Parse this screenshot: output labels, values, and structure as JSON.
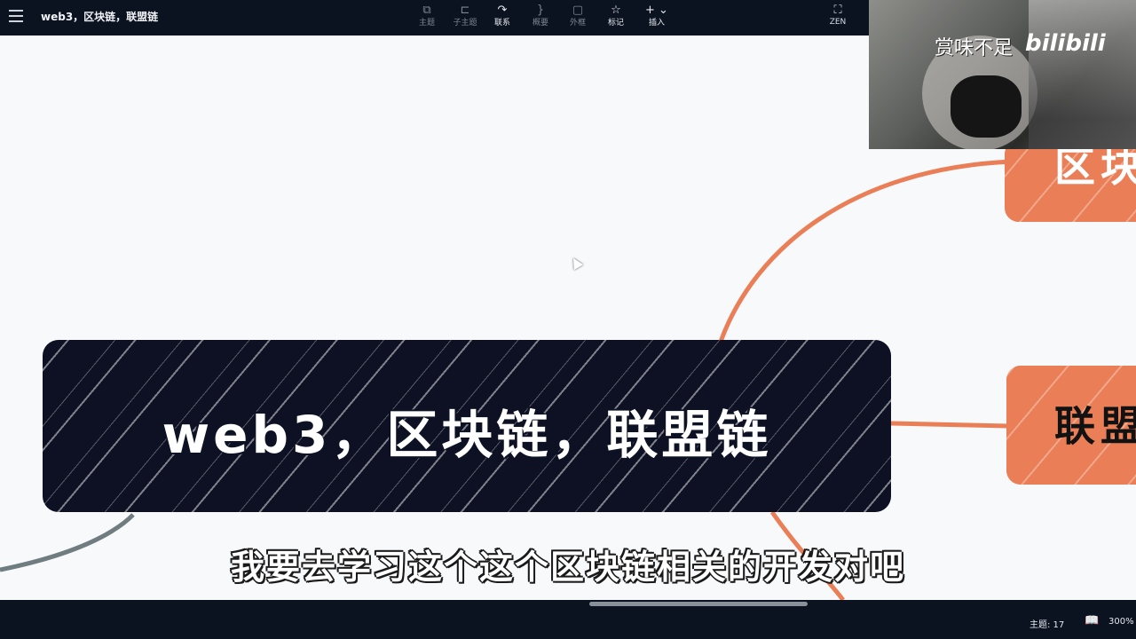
{
  "app": {
    "document_title": "web3，区块链，联盟链"
  },
  "toolbar": {
    "tools": [
      {
        "label": "主题",
        "icon": "topic-icon"
      },
      {
        "label": "子主题",
        "icon": "subtopic-icon"
      },
      {
        "label": "联系",
        "icon": "relationship-icon"
      },
      {
        "label": "概要",
        "icon": "summary-icon"
      },
      {
        "label": "外框",
        "icon": "boundary-icon"
      },
      {
        "label": "标记",
        "icon": "star-icon"
      },
      {
        "label": "插入",
        "icon": "plus-icon"
      }
    ],
    "zen_label": "ZEN"
  },
  "mindmap": {
    "root_label": "web3，区块链，联盟链",
    "children": [
      {
        "label": "区块",
        "color": "#ea7f57"
      },
      {
        "label": "联盟",
        "color": "#ea7f57"
      }
    ],
    "link_color": "#ea7f57",
    "root_color": "#0d1224"
  },
  "subtitle": {
    "text": "我要去学习这个这个区块链相关的开发对吧"
  },
  "webcam": {
    "watermark": "赏味不足",
    "logo": "bilibili"
  },
  "statusbar": {
    "topic_count": "主题: 17",
    "zoom": "300%"
  }
}
